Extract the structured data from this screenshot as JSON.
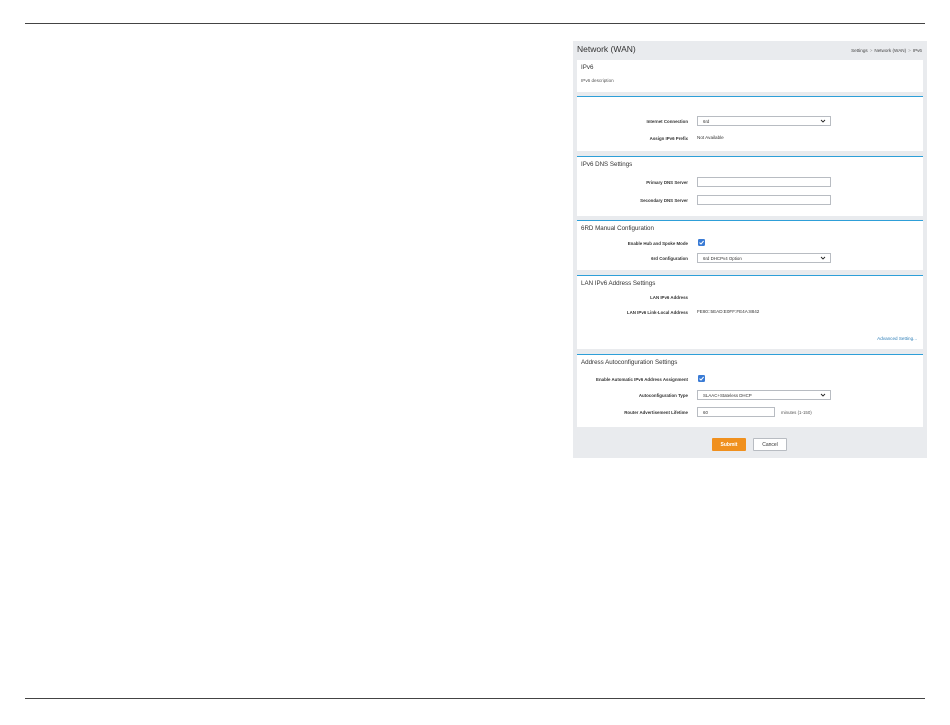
{
  "header": {
    "title": "Network (WAN)",
    "breadcrumb": [
      "Settings",
      "Network (WAN)",
      "IPv6"
    ],
    "breadcrumb_separator": ">"
  },
  "ipv6": {
    "title": "IPv6",
    "description": "IPv6 description"
  },
  "connection": {
    "internet_connection_label": "Internet Connection",
    "internet_connection_value": "6rd",
    "assign_prefix_label": "Assign IPv6 Prefix",
    "assign_prefix_value": "Not Available"
  },
  "dns": {
    "title": "IPv6 DNS Settings",
    "primary_label": "Primary DNS Server",
    "primary_value": "",
    "secondary_label": "Secondary DNS Server",
    "secondary_value": ""
  },
  "sixrd": {
    "title": "6RD Manual Configuration",
    "hub_spoke_label": "Enable Hub and Spoke Mode",
    "hub_spoke_checked": true,
    "config_label": "6rd Configuration",
    "config_value": "6rd DHCPv4 Option"
  },
  "lan": {
    "title": "LAN IPv6 Address Settings",
    "address_label": "LAN IPv6 Address",
    "address_value": "",
    "link_local_label": "LAN IPv6 Link-Local Address",
    "link_local_value": "FE80::5EAD:E0FF:FE4A:8842",
    "advanced_link": "Advanced Setting..."
  },
  "autoconf": {
    "title": "Address Autoconfiguration Settings",
    "enable_label": "Enable Automatic IPv6 Address Assignment",
    "enable_checked": true,
    "type_label": "Autoconfiguration Type",
    "type_value": "SLAAC+Stateless DHCP",
    "lifetime_label": "Router Advertisement Lifetime",
    "lifetime_value": "60",
    "lifetime_hint": "minutes (1-150)"
  },
  "actions": {
    "submit": "Submit",
    "cancel": "Cancel"
  },
  "colors": {
    "accent": "#2e9fd8",
    "submit": "#f0901e",
    "checkbox": "#3a7bd5",
    "link": "#2e7fb8"
  }
}
